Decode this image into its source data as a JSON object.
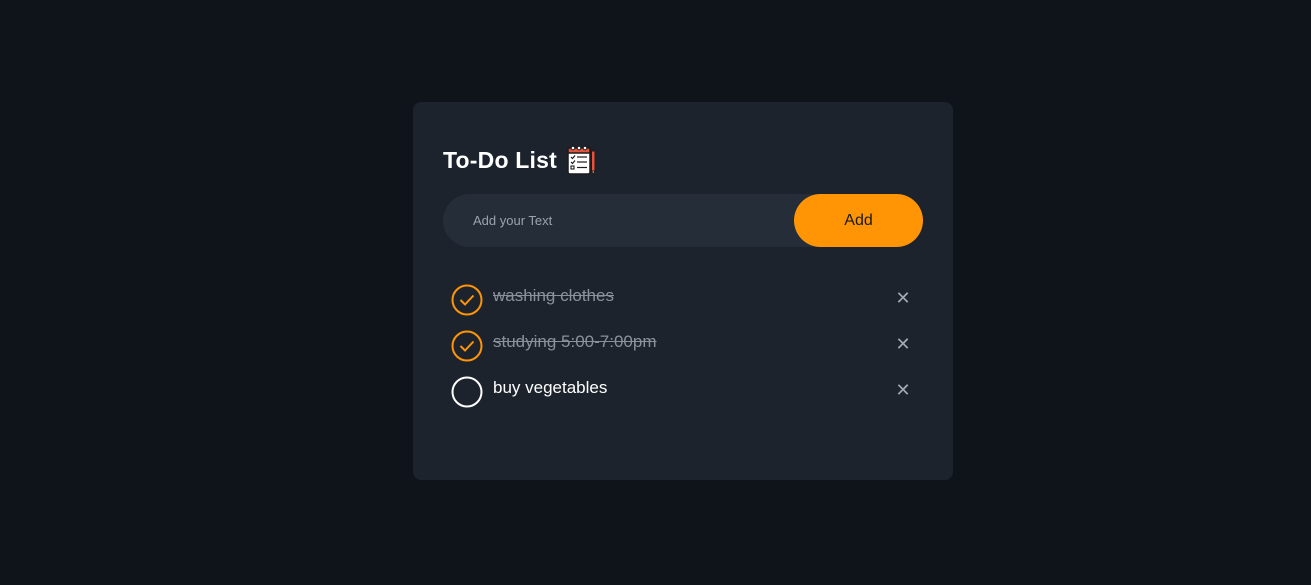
{
  "header": {
    "title": "To-Do List",
    "icon": "notepad-checklist-icon"
  },
  "input": {
    "placeholder": "Add your Text",
    "value": ""
  },
  "add_button": {
    "label": "Add"
  },
  "colors": {
    "page_bg": "#0f141b",
    "card_bg": "#1c232d",
    "input_bg": "#242d38",
    "accent": "#ff9505",
    "completed_text": "#8a919a"
  },
  "todos": [
    {
      "text": "washing clothes",
      "done": true
    },
    {
      "text": "studying 5:00-7:00pm",
      "done": true
    },
    {
      "text": "buy vegetables",
      "done": false
    }
  ],
  "icons": {
    "checked": "checked-circle-icon",
    "unchecked": "unchecked-circle-icon",
    "delete": "close-icon"
  }
}
